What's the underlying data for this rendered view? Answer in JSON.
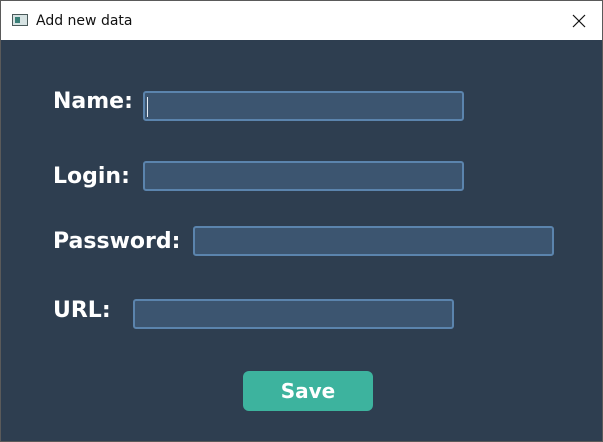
{
  "window": {
    "title": "Add new data",
    "icon": "window-app-icon",
    "close_icon": "close-icon"
  },
  "form": {
    "name_label": "Name:",
    "name_value": "",
    "login_label": "Login:",
    "login_value": "",
    "password_label": "Password:",
    "password_value": "",
    "url_label": "URL:",
    "url_value": "",
    "save_label": "Save"
  },
  "colors": {
    "background": "#2e3e50",
    "field_fill": "#3c5570",
    "field_border": "#5b84ad",
    "accent": "#3db39e",
    "label_text": "#ffffff"
  }
}
